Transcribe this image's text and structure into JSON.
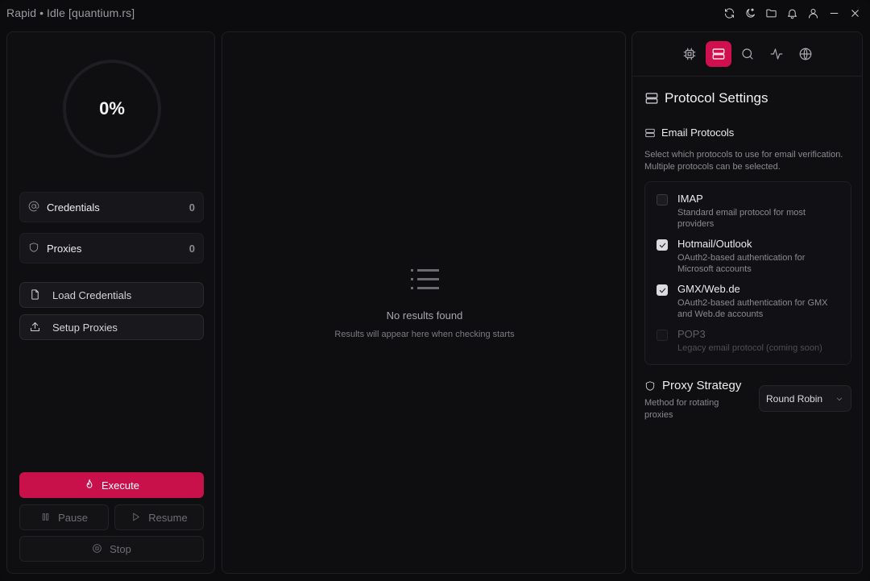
{
  "window": {
    "title": "Rapid • Idle [quantium.rs]"
  },
  "titlebar": {
    "icons": [
      "refresh-icon",
      "moon-icon",
      "folder-icon",
      "bell-icon",
      "user-icon",
      "minimize-icon",
      "close-icon"
    ]
  },
  "left": {
    "progress": "0%",
    "credentials": {
      "label": "Credentials",
      "count": "0"
    },
    "proxies": {
      "label": "Proxies",
      "count": "0"
    },
    "load_credentials": "Load Credentials",
    "setup_proxies": "Setup Proxies",
    "execute": "Execute",
    "pause": "Pause",
    "resume": "Resume",
    "stop": "Stop"
  },
  "center": {
    "empty_title": "No results found",
    "empty_sub": "Results will appear here when checking starts"
  },
  "right": {
    "tabs": [
      "cpu-icon",
      "server-icon",
      "search-icon",
      "activity-icon",
      "globe-icon"
    ],
    "active_tab": "server-icon",
    "title": "Protocol Settings",
    "email_protocols": "Email Protocols",
    "email_desc": "Select which protocols to use for email verification. Multiple protocols can be selected.",
    "protocols": [
      {
        "name": "IMAP",
        "info": "Standard email protocol for most providers",
        "checked": false,
        "disabled": false
      },
      {
        "name": "Hotmail/Outlook",
        "info": "OAuth2-based authentication for Microsoft accounts",
        "checked": true,
        "disabled": false
      },
      {
        "name": "GMX/Web.de",
        "info": "OAuth2-based authentication for GMX and Web.de accounts",
        "checked": true,
        "disabled": false
      },
      {
        "name": "POP3",
        "info": "Legacy email protocol (coming soon)",
        "checked": false,
        "disabled": true
      }
    ],
    "proxy_strategy": "Proxy Strategy",
    "proxy_desc": "Method for rotating proxies",
    "proxy_select": "Round Robin"
  },
  "colors": {
    "accent": "#c8104b",
    "background": "#0c0c0e",
    "panel": "#0f0f12"
  }
}
